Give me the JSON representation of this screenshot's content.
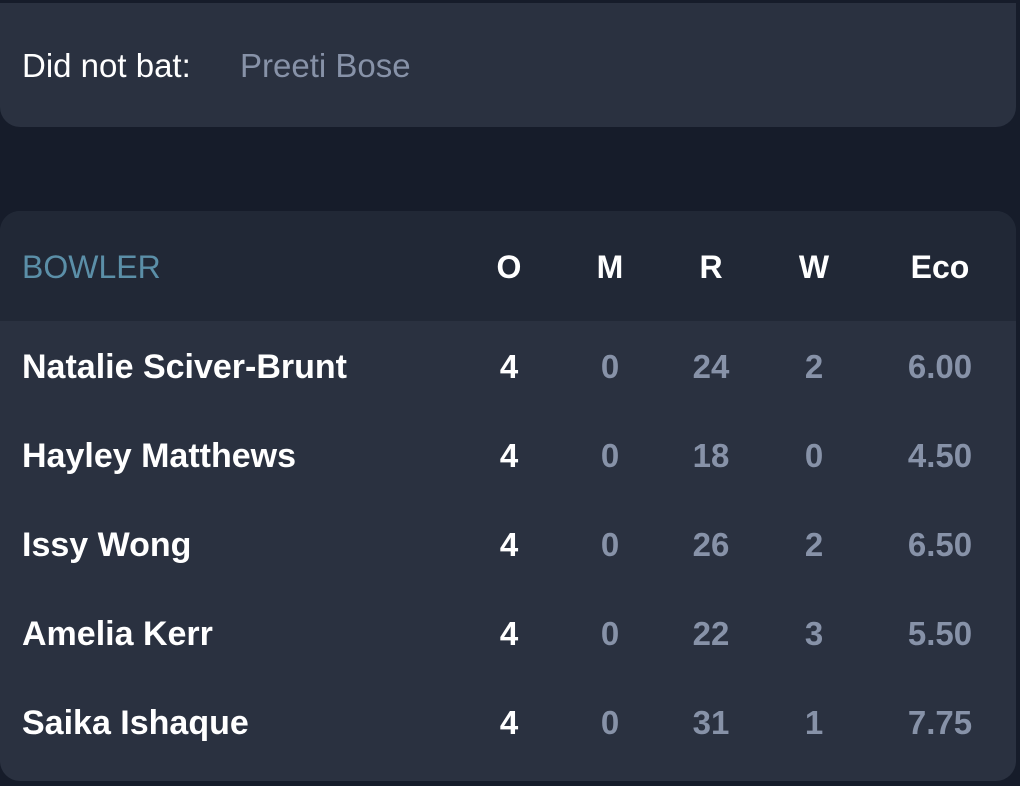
{
  "did_not_bat": {
    "label": "Did not bat:",
    "players": "Preeti Bose"
  },
  "bowling": {
    "headers": {
      "name": "BOWLER",
      "o": "O",
      "m": "M",
      "r": "R",
      "w": "W",
      "eco": "Eco"
    },
    "rows": [
      {
        "name": "Natalie Sciver-Brunt",
        "o": "4",
        "m": "0",
        "r": "24",
        "w": "2",
        "eco": "6.00"
      },
      {
        "name": "Hayley Matthews",
        "o": "4",
        "m": "0",
        "r": "18",
        "w": "0",
        "eco": "4.50"
      },
      {
        "name": "Issy Wong",
        "o": "4",
        "m": "0",
        "r": "26",
        "w": "2",
        "eco": "6.50"
      },
      {
        "name": "Amelia Kerr",
        "o": "4",
        "m": "0",
        "r": "22",
        "w": "3",
        "eco": "5.50"
      },
      {
        "name": "Saika Ishaque",
        "o": "4",
        "m": "0",
        "r": "31",
        "w": "1",
        "eco": "7.75"
      }
    ]
  }
}
